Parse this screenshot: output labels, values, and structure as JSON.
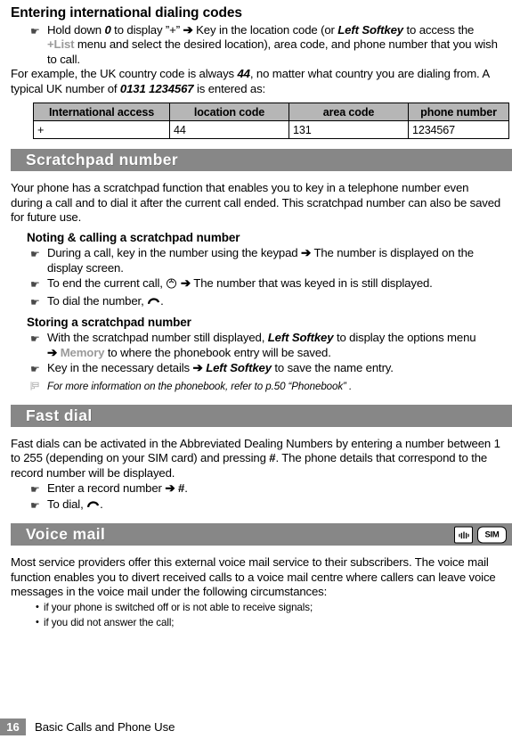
{
  "section_intl": {
    "heading": "Entering international dialing codes",
    "step": {
      "pre": "Hold down ",
      "key": "0",
      "mid1": " to display ”+” ",
      "arrow": "➔",
      "mid2": " Key in the location code (or ",
      "softkey": "Left Softkey",
      "mid3": " to access the ",
      "list": "+List",
      "mid4": " menu and select the desired location), area code, and phone number that you wish to call."
    },
    "para": {
      "pre": "For example, the UK country code is always ",
      "code": "44",
      "mid": ", no matter what country you are dialing from. A typical UK number of ",
      "number": "0131 1234567",
      "post": " is entered as:"
    },
    "table": {
      "headers": [
        "International access",
        "location code",
        "area code",
        "phone number"
      ],
      "rows": [
        [
          "+",
          "44",
          "131",
          "1234567"
        ]
      ]
    }
  },
  "section_scratchpad": {
    "band_title": "Scratchpad number",
    "intro": "Your phone has a scratchpad function that enables you to key in a telephone number even during a call and to dial it after the current call ended. This scratchpad number can also be saved for future use.",
    "noting_heading": "Noting & calling a scratchpad number",
    "noting_steps": [
      {
        "pre": "During a call, key in the number using the keypad ",
        "arrow": "➔",
        "post": " The number is displayed on the display screen."
      },
      {
        "pre": "To end the current call, ",
        "icon": "end-call-icon",
        "arrow": "➔",
        "post": " The number that was keyed in is still displayed."
      },
      {
        "pre": "To dial the number, ",
        "icon": "dial-call-icon",
        "post": "."
      }
    ],
    "storing_heading": "Storing a scratchpad number",
    "storing_steps": [
      {
        "pre": "With the scratchpad number still displayed, ",
        "softkey": "Left Softkey",
        "mid": " to display the options menu ",
        "arrow": "➔",
        "memory": "Memory",
        "post": " to where the phonebook entry will be saved."
      },
      {
        "pre": "Key in the necessary details ",
        "arrow": "➔",
        "softkey": "Left Softkey",
        "post": " to save the name entry."
      }
    ],
    "note": "For more information on the phonebook, refer to p.50 “Phonebook” ."
  },
  "section_fastdial": {
    "band_title": "Fast dial",
    "intro": {
      "pre": "Fast dials can be activated in the Abbreviated Dealing Numbers by entering a number between 1 to 255 (depending on your SIM card) and pressing ",
      "hash": "#",
      "post": ". The phone details that correspond to the record number will be displayed."
    },
    "steps": [
      {
        "pre": "Enter a record number ",
        "arrow": "➔",
        "hash": "#",
        "post": "."
      },
      {
        "pre": "To dial, ",
        "icon": "dial-call-icon",
        "post": "."
      }
    ]
  },
  "section_voicemail": {
    "band_title": "Voice mail",
    "badges": [
      {
        "name": "network-service-icon",
        "label": ""
      },
      {
        "name": "sim-icon",
        "label": "SIM"
      }
    ],
    "intro": "Most service providers offer this external voice mail service to their subscribers. The voice mail function enables you to divert received calls to a voice mail centre where callers can leave voice messages in the voice mail under the following circumstances:",
    "conditions": [
      "if your phone is switched off or is not able to receive signals;",
      "if you did not answer the call;"
    ]
  },
  "footer": {
    "page_number": "16",
    "chapter": "Basic Calls and Phone Use"
  },
  "icons": {
    "hand_bullet": "☛",
    "dot_bullet": "•"
  },
  "colors": {
    "band": "#878787",
    "table_header": "#b6b6b6",
    "grey_text": "#9a9a9a"
  }
}
